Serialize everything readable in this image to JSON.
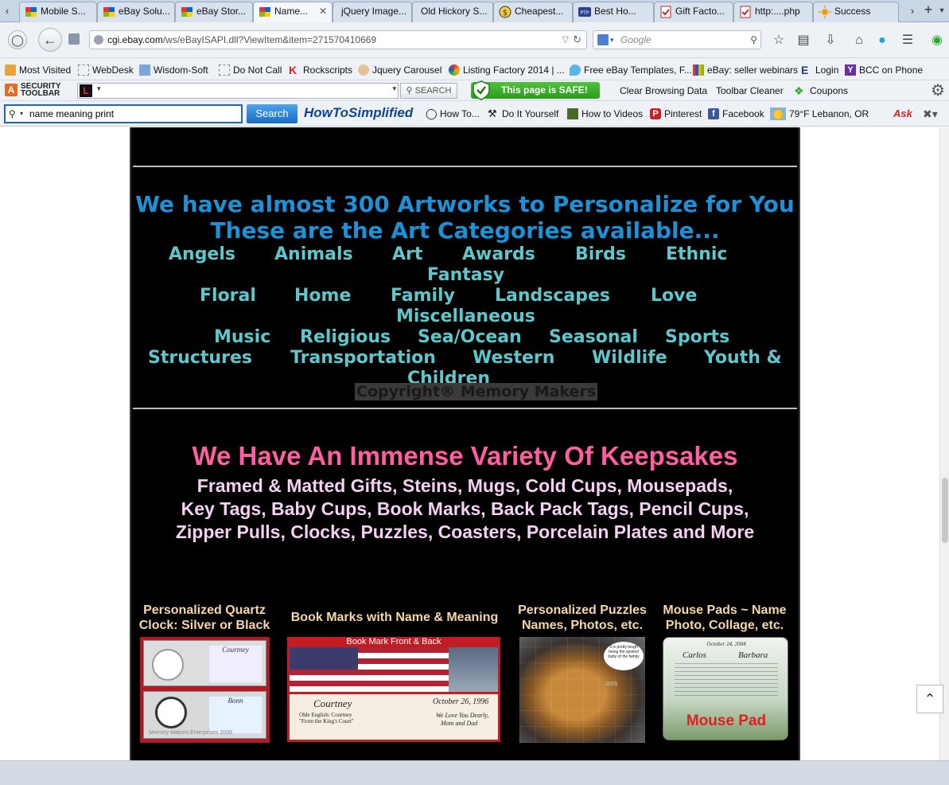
{
  "tabs": [
    {
      "label": "Mobile S..."
    },
    {
      "label": "eBay Solu..."
    },
    {
      "label": "eBay Stor..."
    },
    {
      "label": "Name..."
    },
    {
      "label": "jQuery Image..."
    },
    {
      "label": "Old Hickory S..."
    },
    {
      "label": "Cheapest..."
    },
    {
      "label": "Best Ho..."
    },
    {
      "label": "Gift Facto..."
    },
    {
      "label": "http:....php"
    },
    {
      "label": "Success"
    }
  ],
  "nav": {
    "url_host": "cgi.ebay.com",
    "url_path": "/ws/eBayISAPI.dll?ViewItem&item=271570410669",
    "search_placeholder": "Google"
  },
  "bookmarks": [
    {
      "label": "Most Visited"
    },
    {
      "label": "WebDesk"
    },
    {
      "label": "Wisdom-Soft"
    },
    {
      "label": "Do Not Call"
    },
    {
      "label": "Rockscripts"
    },
    {
      "label": "Jquery Carousel"
    },
    {
      "label": "Listing Factory 2014 | ..."
    },
    {
      "label": "Free eBay Templates, F..."
    },
    {
      "label": "eBay: seller webinars"
    },
    {
      "label": "Login"
    },
    {
      "label": "BCC on Phone"
    }
  ],
  "security_toolbar": {
    "logo_line1": "SECURITY",
    "logo_line2": "TOOLBAR",
    "search_label": "SEARCH",
    "safe_label": "This page is SAFE!",
    "links": [
      "Clear Browsing Data",
      "Toolbar Cleaner",
      "Coupons"
    ]
  },
  "howto_toolbar": {
    "search_value": "name meaning print",
    "search_button": "Search",
    "brand": "HowToSimplified",
    "links": [
      "How To...",
      "Do It Yourself",
      "How to Videos",
      "Pinterest",
      "Facebook",
      "79°F Lebanon, OR"
    ]
  },
  "content": {
    "artworks_heading": "We have almost 300 Artworks to Personalize for You",
    "categories_heading": "These are the Art Categories available...",
    "categories": [
      "Angels",
      "Animals",
      "Art",
      "Awards",
      "Birds",
      "Ethnic",
      "Fantasy",
      "Floral",
      "Home",
      "Family",
      "Landscapes",
      "Love",
      "Miscellaneous",
      "Music",
      "Religious",
      "Sea/Ocean",
      "Seasonal",
      "Sports",
      "Structures",
      "Transportation",
      "Western",
      "Wildlife",
      "Youth &",
      "Children"
    ],
    "copyright": "Copyright® Memory Makers",
    "keepsakes_heading": "We Have An Immense Variety Of Keepsakes",
    "keepsakes_lines": [
      "Framed & Matted Gifts, Steins, Mugs, Cold Cups, Mousepads,",
      "Key Tags, Baby Cups, Book Marks, Back Pack Tags, Pencil Cups,",
      "Zipper Pulls, Clocks, Puzzles, Coasters, Porcelain Plates and More"
    ],
    "products": [
      {
        "title_line1": "Personalized Quartz",
        "title_line2": "Clock: Silver or Black",
        "image_text": [
          "Courtney",
          "Bonn",
          "Memory Makers Enterprises 2006"
        ]
      },
      {
        "title_line1": "Book Marks with Name & Meaning",
        "title_line2": "",
        "image_text": [
          "Book Mark Front & Back",
          "Courtney",
          "Olde English: Courtney",
          "\"From the King's Court\"",
          "October 26, 1996",
          "We Love You Dearly,",
          "Mom and Dad"
        ]
      },
      {
        "title_line1": "Personalized Puzzles",
        "title_line2": "Names, Photos, etc.",
        "image_text": [
          "It is pretty tough being the spoiled baby of the family",
          "2005"
        ]
      },
      {
        "title_line1": "Mouse Pads ~ Name",
        "title_line2": "Photo, Collage, etc.",
        "image_text": [
          "October 24, 2004",
          "Carlos",
          "Barbara",
          "Mouse Pad"
        ]
      }
    ]
  },
  "colors": {
    "artworks_heading": "#1e90d6",
    "category": "#5fc6cc",
    "keepsakes_heading": "#ff5fa2",
    "keepsakes_text": "#f6d0f2",
    "product_title": "#f7d7a7"
  }
}
